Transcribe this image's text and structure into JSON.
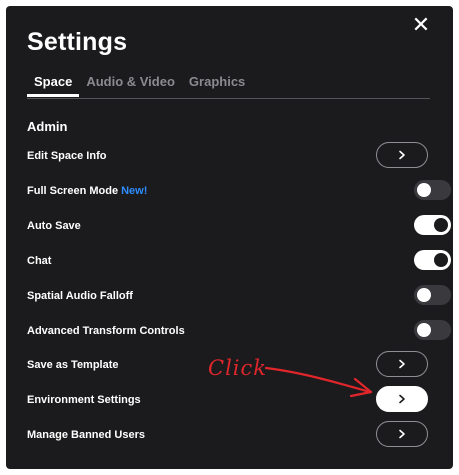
{
  "header": {
    "title": "Settings",
    "close_symbol": "✕"
  },
  "tabs": [
    {
      "label": "Space",
      "active": true
    },
    {
      "label": "Audio & Video",
      "active": false
    },
    {
      "label": "Graphics",
      "active": false
    }
  ],
  "section": {
    "heading": "Admin"
  },
  "rows": [
    {
      "label": "Edit Space Info",
      "control": "chevron-button"
    },
    {
      "label": "Full Screen Mode",
      "badge": "New!",
      "control": "toggle",
      "on": false
    },
    {
      "label": "Auto Save",
      "control": "toggle",
      "on": true
    },
    {
      "label": "Chat",
      "control": "toggle",
      "on": true
    },
    {
      "label": "Spatial Audio Falloff",
      "control": "toggle",
      "on": false
    },
    {
      "label": "Advanced Transform Controls",
      "control": "toggle",
      "on": false
    },
    {
      "label": "Save as Template",
      "control": "chevron-button"
    },
    {
      "label": "Environment Settings",
      "control": "chevron-button",
      "highlighted": true
    },
    {
      "label": "Manage Banned Users",
      "control": "chevron-button"
    }
  ],
  "annotation": {
    "text": "Click",
    "color": "#e0262b"
  },
  "colors": {
    "panel_background": "#1b1b1d",
    "badge_blue": "#2f8cff",
    "inactive_tab": "#8a8a90"
  },
  "icons": {
    "close": "close-icon",
    "chevron": "chevron-right-icon",
    "arrow": "arrow-annotation"
  }
}
